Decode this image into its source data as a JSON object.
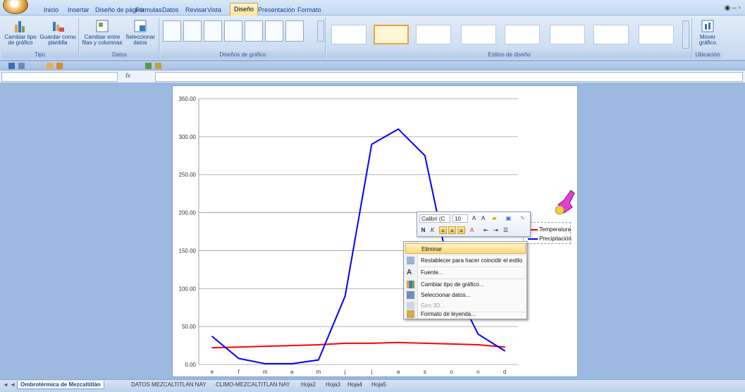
{
  "ribbon_tabs": [
    "Inicio",
    "Insertar",
    "Diseño de página",
    "Fórmulas",
    "Datos",
    "Revisar",
    "Vista",
    "Diseño",
    "Presentación",
    "Formato"
  ],
  "active_tab": "Diseño",
  "groups": {
    "tipo": {
      "title": "Tipo",
      "cambiar_tipo": "Cambiar tipo de gráfico",
      "guardar_plantilla": "Guardar como plantilla"
    },
    "datos": {
      "title": "Datos",
      "cambiar_filas": "Cambiar entre filas y columnas",
      "seleccionar_datos": "Seleccionar datos"
    },
    "diseno": {
      "title": "Diseños de gráfico"
    },
    "estilos": {
      "title": "Estilos de diseño"
    },
    "ubicacion": {
      "title": "Ubicación",
      "mover": "Mover gráfico"
    }
  },
  "formula": {
    "fx": "fx"
  },
  "sheet_tabs": [
    "Ombrotérmica de Mezcaltitlán",
    "DATOS MEZCALTITLAN NAY",
    "CLIMO-MEZCALTITLAN NAY",
    "Hoja2",
    "Hoja3",
    "Hoja4",
    "Hoja5"
  ],
  "mini_toolbar": {
    "font": "Calibri (C",
    "size": "10"
  },
  "context_menu": [
    {
      "label": "Eliminar",
      "state": "highlight"
    },
    {
      "label": "Restablecer para hacer coincidir el estilo",
      "state": "normal"
    },
    {
      "label": "Fuente...",
      "state": "normal"
    },
    {
      "label": "Cambiar tipo de gráfico...",
      "state": "normal"
    },
    {
      "label": "Seleccionar datos...",
      "state": "normal"
    },
    {
      "label": "Giro 3D...",
      "state": "disabled"
    },
    {
      "label": "Formato de leyenda...",
      "state": "normal"
    }
  ],
  "colors": {
    "temperatura": "#ff0000",
    "precipitacion": "#0000ff",
    "ribbon": "#c6d8ef",
    "workspace": "#9cb9e0"
  },
  "chart_data": {
    "type": "line",
    "categories": [
      "e",
      "f",
      "m",
      "a",
      "m",
      "j",
      "j",
      "a",
      "s",
      "o",
      "n",
      "d"
    ],
    "y_tick_labels": [
      "0.00",
      "50.00",
      "100.00",
      "150.00",
      "200.00",
      "250.00",
      "300.00",
      "350.00"
    ],
    "ylim": [
      0,
      350
    ],
    "grid": true,
    "legend": "right",
    "series": [
      {
        "name": "Temperatura",
        "values": [
          22,
          23,
          24,
          25,
          26,
          28,
          28,
          29,
          28,
          27,
          26,
          23
        ]
      },
      {
        "name": "Precipitación",
        "values": [
          37,
          8,
          1,
          1,
          6,
          90,
          290,
          310,
          275,
          110,
          40,
          18
        ]
      }
    ]
  }
}
